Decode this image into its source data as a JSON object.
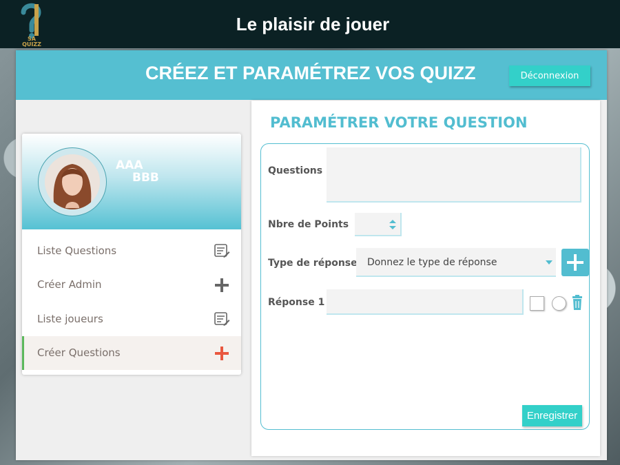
{
  "topbar": {
    "title": "Le plaisir de jouer",
    "logo_text": "SA QUIZZ"
  },
  "header": {
    "title": "CRÉEZ ET PARAMÉTREZ VOS QUIZZ",
    "logout_label": "Déconnexion"
  },
  "profile": {
    "first_name": "AAA",
    "last_name": "BBB"
  },
  "sidebar": {
    "items": [
      {
        "label": "Liste Questions",
        "icon": "list-edit-icon"
      },
      {
        "label": "Créer Admin",
        "icon": "plus-icon"
      },
      {
        "label": "Liste joueurs",
        "icon": "list-edit-icon"
      },
      {
        "label": "Créer Questions",
        "icon": "plus-icon",
        "active": true
      }
    ]
  },
  "form": {
    "title": "PARAMÉTRER VOTRE QUESTION",
    "questions_label": "Questions",
    "points_label": "Nbre de Points",
    "type_label": "Type de réponse",
    "type_placeholder": "Donnez le type de réponse",
    "answer_label": "Réponse 1",
    "save_label": "Enregistrer"
  },
  "colors": {
    "accent": "#52bdd0",
    "button": "#33d0c9",
    "topbar": "#0b2124",
    "active_plus": "#e9573f"
  }
}
